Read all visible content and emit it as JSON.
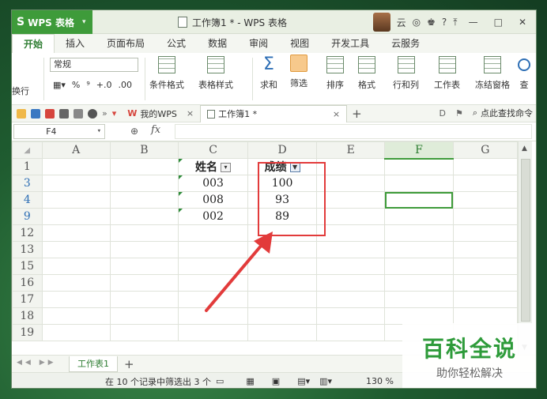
{
  "app": {
    "name": "WPS 表格",
    "logo": "S"
  },
  "window": {
    "title": "工作簿1 * - WPS 表格",
    "user": "云",
    "controls": {
      "minimize": "—",
      "maximize": "□",
      "close": "✕"
    }
  },
  "menu": {
    "tabs": [
      "开始",
      "插入",
      "页面布局",
      "公式",
      "数据",
      "审阅",
      "视图",
      "开发工具",
      "云服务"
    ],
    "active": "开始"
  },
  "ribbon": {
    "number_format": "常规",
    "percent": "%",
    "comma": "⁹",
    "dec_inc": "+.0",
    "dec_dec": ".00",
    "left_cut": "换行",
    "buttons": [
      "条件格式",
      "表格样式",
      "求和",
      "筛选",
      "排序",
      "格式",
      "行和列",
      "工作表",
      "冻结窗格",
      "查"
    ]
  },
  "toolbar": {
    "wps_tab": "我的WPS",
    "doc_tab": "工作簿1 *",
    "add": "+",
    "search": "点此查找命令"
  },
  "formula": {
    "name_box": "F4",
    "fx": "fx",
    "value": ""
  },
  "columns": [
    "A",
    "B",
    "C",
    "D",
    "E",
    "F",
    "G"
  ],
  "rows": [
    {
      "num": "1",
      "filtered": false,
      "c": "姓名",
      "d": "成绩",
      "header": true
    },
    {
      "num": "3",
      "filtered": true,
      "c": "003",
      "d": "100"
    },
    {
      "num": "4",
      "filtered": true,
      "c": "008",
      "d": "93"
    },
    {
      "num": "9",
      "filtered": true,
      "c": "002",
      "d": "89"
    },
    {
      "num": "12",
      "filtered": false,
      "c": "",
      "d": ""
    },
    {
      "num": "13",
      "filtered": false,
      "c": "",
      "d": ""
    },
    {
      "num": "15",
      "filtered": false,
      "c": "",
      "d": ""
    },
    {
      "num": "16",
      "filtered": false,
      "c": "",
      "d": ""
    },
    {
      "num": "17",
      "filtered": false,
      "c": "",
      "d": ""
    },
    {
      "num": "18",
      "filtered": false,
      "c": "",
      "d": ""
    },
    {
      "num": "19",
      "filtered": false,
      "c": "",
      "d": ""
    }
  ],
  "sheet": {
    "tab": "工作表1",
    "add": "+"
  },
  "status": {
    "text": "在 10 个记录中筛选出 3 个",
    "zoom": "130 %"
  },
  "watermark": {
    "title": "百科全说",
    "subtitle": "助你轻松解决"
  }
}
